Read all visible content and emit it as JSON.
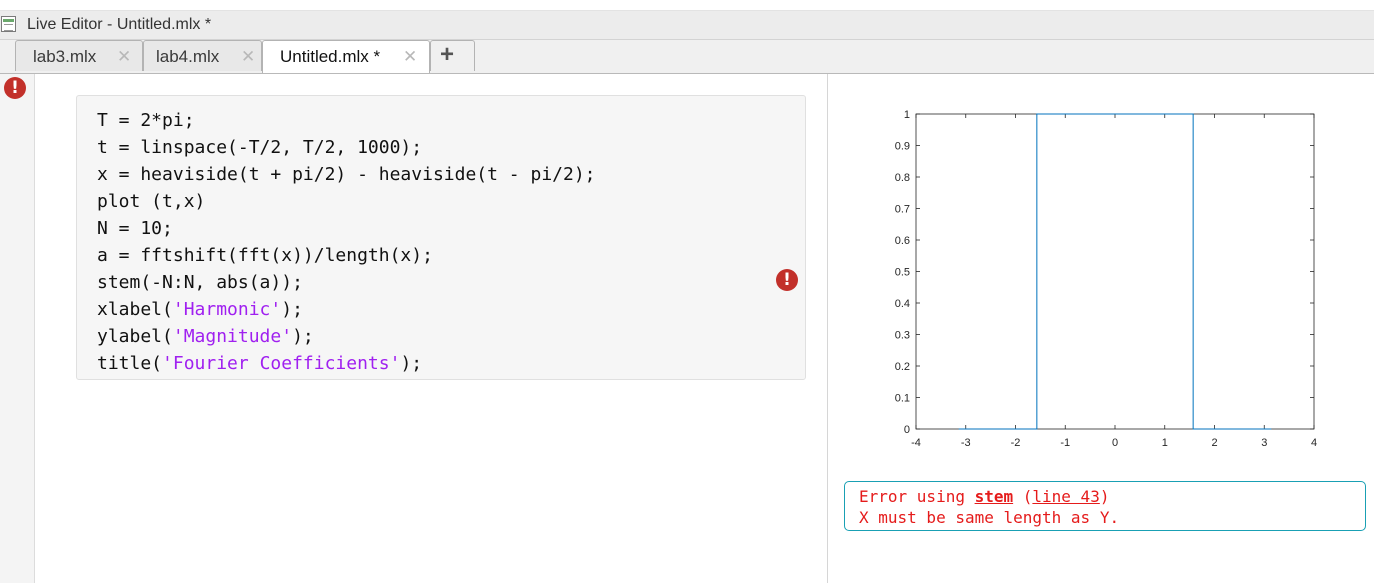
{
  "window": {
    "title": "Live Editor - Untitled.mlx *"
  },
  "tabs": [
    {
      "label": "lab3.mlx",
      "close": "✕"
    },
    {
      "label": "lab4.mlx",
      "close": "✕"
    },
    {
      "label": "Untitled.mlx *",
      "close": "✕"
    }
  ],
  "add_tab": "+",
  "icons": {
    "error": "!"
  },
  "code": {
    "lines": [
      [
        {
          "t": "T = 2*pi;"
        }
      ],
      [
        {
          "t": "t = linspace(-T/2, T/2, 1000);"
        }
      ],
      [
        {
          "t": "x = heaviside(t + pi/2) - heaviside(t - pi/2);"
        }
      ],
      [
        {
          "t": "plot (t,x)"
        }
      ],
      [
        {
          "t": "N = 10;"
        }
      ],
      [
        {
          "t": "a = fftshift(fft(x))/length(x);"
        }
      ],
      [
        {
          "t": "stem(-N:N, abs(a));"
        }
      ],
      [
        {
          "t": "xlabel("
        },
        {
          "t": "'Harmonic'",
          "s": true
        },
        {
          "t": ");"
        }
      ],
      [
        {
          "t": "ylabel("
        },
        {
          "t": "'Magnitude'",
          "s": true
        },
        {
          "t": ");"
        }
      ],
      [
        {
          "t": "title("
        },
        {
          "t": "'Fourier Coefficients'",
          "s": true
        },
        {
          "t": ");"
        }
      ]
    ],
    "string_color": "#a020f0"
  },
  "chart_data": {
    "type": "line",
    "xlim": [
      -4,
      4
    ],
    "ylim": [
      0,
      1
    ],
    "xticks": [
      -4,
      -3,
      -2,
      -1,
      0,
      1,
      2,
      3,
      4
    ],
    "yticks": [
      0,
      0.1,
      0.2,
      0.3,
      0.4,
      0.5,
      0.6,
      0.7,
      0.8,
      0.9,
      1
    ],
    "ytick_labels": [
      "0",
      "0.1",
      "0.2",
      "0.3",
      "0.4",
      "0.5",
      "0.6",
      "0.7",
      "0.8",
      "0.9",
      "1"
    ],
    "series": [
      {
        "color": "#0072bd",
        "x": [
          -3.1416,
          -1.5708,
          -1.5708,
          1.5708,
          1.5708,
          3.1416
        ],
        "y": [
          0,
          0,
          1,
          1,
          0,
          0
        ]
      }
    ],
    "grid": false
  },
  "error": {
    "prefix": "Error using ",
    "function": "stem",
    "open": " (",
    "line_link": "line 43",
    "close": ")",
    "message": "X must be same length as Y."
  }
}
